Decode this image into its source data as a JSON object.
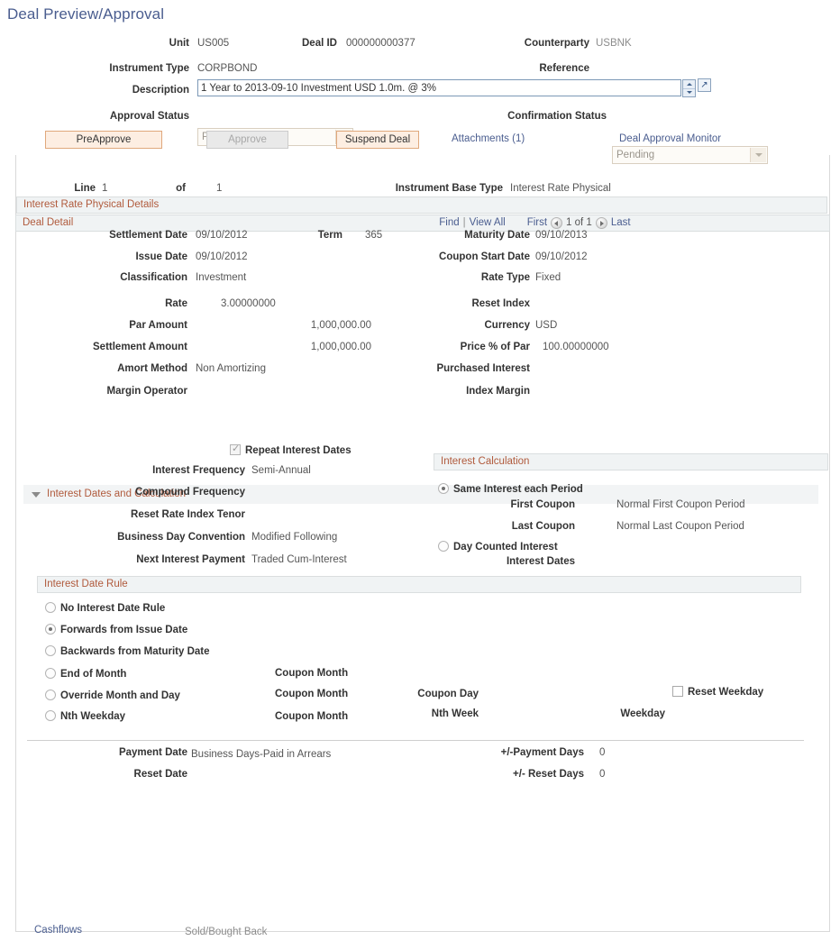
{
  "page": {
    "title": "Deal Preview/Approval"
  },
  "header": {
    "unit_label": "Unit",
    "unit_value": "US005",
    "deal_id_label": "Deal ID",
    "deal_id_value": "000000000377",
    "counterparty_label": "Counterparty",
    "counterparty_value": "USBNK",
    "instrument_type_label": "Instrument Type",
    "instrument_type_value": "CORPBOND",
    "reference_label": "Reference",
    "reference_value": "",
    "description_label": "Description",
    "description_value": "1 Year to 2013-09-10 Investment USD 1.0m. @ 3%",
    "approval_status_label": "Approval Status",
    "approval_status_value": "Pending Review",
    "confirmation_status_label": "Confirmation Status",
    "confirmation_status_value": "Pending"
  },
  "actions": {
    "preapprove": "PreApprove",
    "approve": "Approve",
    "suspend": "Suspend Deal",
    "attachments": "Attachments (1)",
    "monitor": "Deal Approval Monitor"
  },
  "deal_detail": {
    "title": "Deal Detail",
    "find": "Find",
    "divider": "|",
    "view_all": "View All",
    "first": "First",
    "counter": "1 of 1",
    "last": "Last",
    "line_label": "Line",
    "line_value": "1",
    "of_label": "of",
    "of_value": "1",
    "instrument_base_type_label": "Instrument Base Type",
    "instrument_base_type_value": "Interest Rate Physical"
  },
  "physical_details": {
    "title": "Interest Rate Physical Details",
    "settlement_date_label": "Settlement Date",
    "settlement_date_value": "09/10/2012",
    "term_label": "Term",
    "term_value": "365",
    "maturity_date_label": "Maturity Date",
    "maturity_date_value": "09/10/2013",
    "issue_date_label": "Issue Date",
    "issue_date_value": "09/10/2012",
    "coupon_start_date_label": "Coupon Start Date",
    "coupon_start_date_value": "09/10/2012",
    "classification_label": "Classification",
    "classification_value": "Investment",
    "rate_type_label": "Rate Type",
    "rate_type_value": "Fixed",
    "rate_label": "Rate",
    "rate_value": "3.00000000",
    "reset_index_label": "Reset Index",
    "reset_index_value": "",
    "par_amount_label": "Par Amount",
    "par_amount_value": "1,000,000.00",
    "currency_label": "Currency",
    "currency_value": "USD",
    "settlement_amount_label": "Settlement Amount",
    "settlement_amount_value": "1,000,000.00",
    "price_pct_par_label": "Price % of Par",
    "price_pct_par_value": "100.00000000",
    "amort_method_label": "Amort Method",
    "amort_method_value": "Non Amortizing",
    "purchased_interest_label": "Purchased Interest",
    "purchased_interest_value": "",
    "margin_operator_label": "Margin Operator",
    "margin_operator_value": "",
    "index_margin_label": "Index Margin",
    "index_margin_value": ""
  },
  "interest_dates": {
    "title": "Interest Dates and Calculation",
    "repeat_interest_dates_label": "Repeat Interest Dates",
    "repeat_interest_dates_checked": true,
    "interest_frequency_label": "Interest Frequency",
    "interest_frequency_value": "Semi-Annual",
    "compound_frequency_label": "Compound Frequency",
    "compound_frequency_value": "",
    "reset_rate_index_tenor_label": "Reset Rate Index Tenor",
    "reset_rate_index_tenor_value": "",
    "business_day_convention_label": "Business Day Convention",
    "business_day_convention_value": "Modified Following",
    "next_interest_payment_label": "Next Interest Payment",
    "next_interest_payment_value": "Traded Cum-Interest"
  },
  "interest_calculation": {
    "title": "Interest Calculation",
    "same_interest_label": "Same Interest each Period",
    "same_interest_selected": true,
    "first_coupon_label": "First Coupon",
    "first_coupon_value": "Normal First Coupon Period",
    "last_coupon_label": "Last Coupon",
    "last_coupon_value": "Normal Last Coupon Period",
    "day_counted_label": "Day Counted Interest",
    "day_counted_selected": false,
    "interest_dates_label": "Interest Dates",
    "interest_dates_value": ""
  },
  "interest_date_rule": {
    "title": "Interest Date Rule",
    "options": [
      {
        "label": "No Interest Date Rule",
        "selected": false
      },
      {
        "label": "Forwards from Issue Date",
        "selected": true
      },
      {
        "label": "Backwards from Maturity Date",
        "selected": false
      },
      {
        "label": "End of Month",
        "selected": false
      },
      {
        "label": "Override Month and Day",
        "selected": false
      },
      {
        "label": "Nth Weekday",
        "selected": false
      }
    ],
    "coupon_month_1_label": "Coupon Month",
    "coupon_month_2_label": "Coupon Month",
    "coupon_month_3_label": "Coupon Month",
    "coupon_day_label": "Coupon Day",
    "nth_week_label": "Nth Week",
    "weekday_label": "Weekday",
    "reset_weekday_label": "Reset Weekday",
    "reset_weekday_checked": false
  },
  "payment_section": {
    "payment_date_label": "Payment Date",
    "payment_date_value": "Business Days-Paid in Arrears",
    "payment_days_label": "+/-Payment Days",
    "payment_days_value": "0",
    "reset_date_label": "Reset Date",
    "reset_date_value": "",
    "reset_days_label": "+/- Reset Days",
    "reset_days_value": "0"
  },
  "footer": {
    "cashflows": "Cashflows",
    "sold_bought_back": "Sold/Bought Back"
  },
  "colors": {
    "title_blue": "#4a5d8f",
    "section_orange": "#b05a3c",
    "button_orange_bg": "#fdeee2",
    "button_orange_border": "#e0a87c"
  }
}
